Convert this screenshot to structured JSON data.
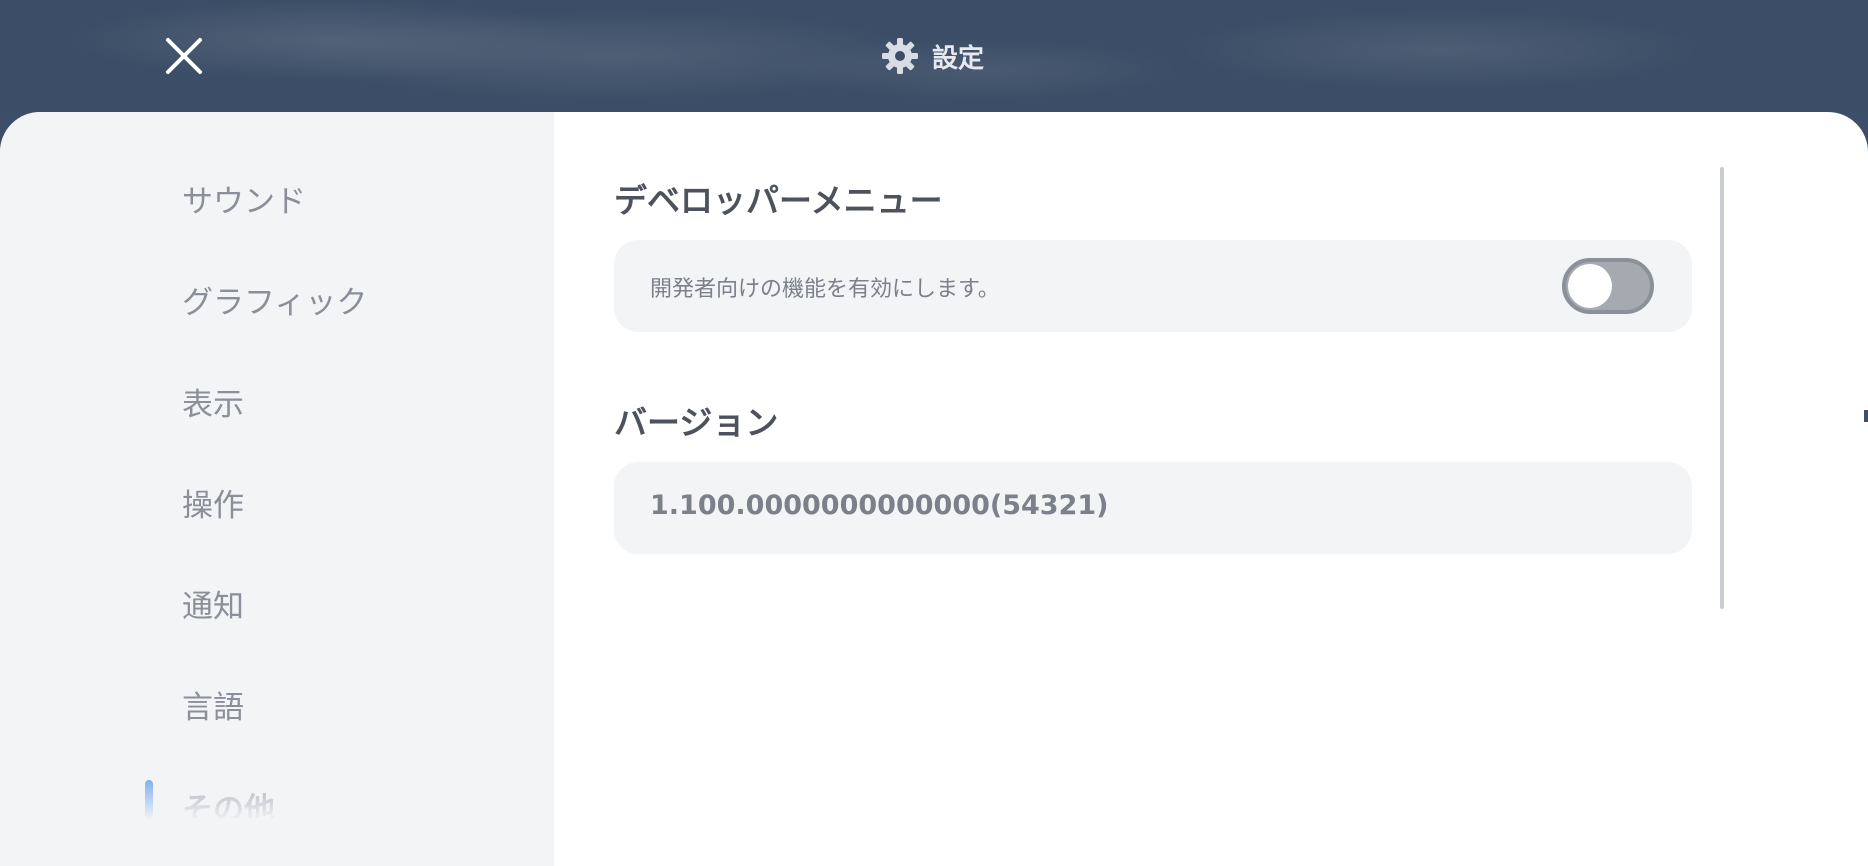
{
  "header": {
    "title": "設定",
    "close_icon": "close-icon",
    "settings_icon": "gear-icon",
    "colors": {
      "background": "#3c4e67",
      "title_text": "#e6e9ee"
    }
  },
  "sidebar": {
    "items": [
      {
        "label": "サウンド"
      },
      {
        "label": "グラフィック"
      },
      {
        "label": "表示"
      },
      {
        "label": "操作"
      },
      {
        "label": "通知"
      },
      {
        "label": "言語"
      },
      {
        "label": "その他"
      }
    ],
    "active_index": 6,
    "colors": {
      "background": "#f3f4f6",
      "text": "#8a8f99",
      "indicator": "#7fb1f0"
    }
  },
  "main": {
    "developer_menu": {
      "title": "デベロッパーメニュー",
      "description": "開発者向けの機能を有効にします。",
      "toggle_on": false
    },
    "version": {
      "title": "バージョン",
      "value": "1.100.0000000000000(54321)"
    }
  }
}
